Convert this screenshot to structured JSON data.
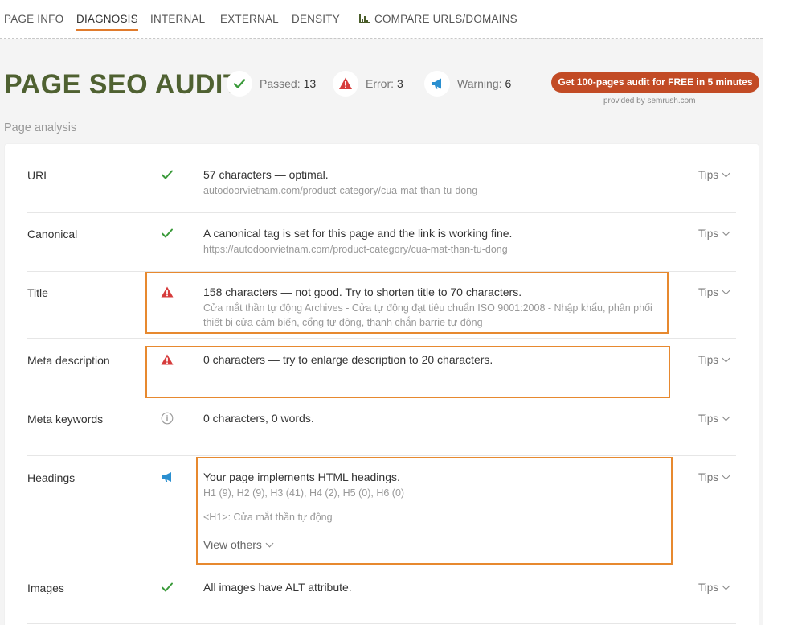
{
  "nav": {
    "tabs": [
      {
        "label": "PAGE INFO"
      },
      {
        "label": "DIAGNOSIS"
      },
      {
        "label": "INTERNAL"
      },
      {
        "label": "EXTERNAL"
      },
      {
        "label": "DENSITY"
      },
      {
        "label": "COMPARE URLS/DOMAINS",
        "icon": "bar-chart-icon"
      }
    ],
    "active_tab": "DIAGNOSIS"
  },
  "header": {
    "title": "PAGE SEO AUDIT",
    "stats": {
      "passed": {
        "label": "Passed:",
        "value": "13",
        "icon": "check-icon"
      },
      "error": {
        "label": "Error:",
        "value": "3",
        "icon": "error-triangle-icon"
      },
      "warning": {
        "label": "Warning:",
        "value": "6",
        "icon": "megaphone-icon"
      }
    },
    "cta": "Get 100-pages audit for FREE in 5 minutes",
    "provided_by": "provided by  semrush.com"
  },
  "section_label": "Page analysis",
  "rows": [
    {
      "label": "URL",
      "status": "passed",
      "main": "57 characters — optimal.",
      "sub": "autodoorvietnam.com/product-category/cua-mat-than-tu-dong",
      "tips": "Tips"
    },
    {
      "label": "Canonical",
      "status": "passed",
      "main": "A canonical tag is set for this page and the link is working fine.",
      "sub": "https://autodoorvietnam.com/product-category/cua-mat-than-tu-dong",
      "tips": "Tips"
    },
    {
      "label": "Title",
      "status": "error",
      "main": "158 characters — not good. Try to shorten title to 70 characters.",
      "sub_line1": "Cửa mắt thần tự động Archives - Cửa tự động đạt tiêu chuẩn ISO 9001:2008 - Nhập khẩu, phân phối",
      "sub_line2": "thiết bị cửa cảm biến, cổng tự động, thanh chắn barrie tự động",
      "tips": "Tips"
    },
    {
      "label": "Meta description",
      "status": "error",
      "main": "0 characters — try to enlarge description to 20 characters.",
      "tips": "Tips"
    },
    {
      "label": "Meta keywords",
      "status": "info",
      "main": "0 characters, 0 words.",
      "tips": "Tips"
    },
    {
      "label": "Headings",
      "status": "warning",
      "main": "Your page implements HTML headings.",
      "sub": "H1 (9), H2 (9), H3 (41), H4 (2), H5 (0), H6 (0)",
      "h1": "<H1>: Cửa mắt thần tự động",
      "view_others": "View others",
      "tips": "Tips"
    },
    {
      "label": "Images",
      "status": "passed",
      "main": "All images have ALT attribute.",
      "tips": "Tips"
    }
  ],
  "colors": {
    "title_green": "#4f6131",
    "passed": "#3a9a3a",
    "error": "#d63b3b",
    "warning": "#2a8fd0",
    "cta": "#c24b25",
    "highlight": "#e7892f",
    "active_tab_underline": "#e07b2c"
  }
}
